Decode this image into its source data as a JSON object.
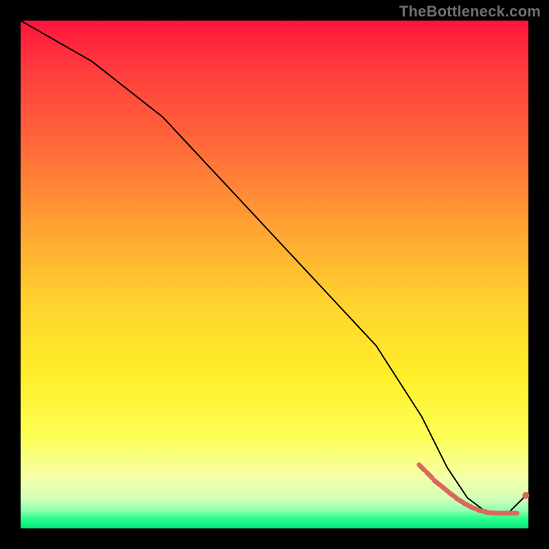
{
  "watermark": "TheBottleneck.com",
  "colors": {
    "frame_bg": "#000000",
    "marker": "#d86a5c",
    "curve": "#000000",
    "gradient_top": "#ff143c",
    "gradient_bottom": "#00e77a"
  },
  "chart_data": {
    "type": "line",
    "title": "",
    "xlabel": "",
    "ylabel": "",
    "xlim": [
      0,
      100
    ],
    "ylim": [
      0,
      100
    ],
    "grid": false,
    "curve": {
      "name": "black-curve",
      "x": [
        0,
        14,
        28,
        42,
        56,
        70,
        79,
        84,
        88,
        92,
        96,
        100
      ],
      "y": [
        100,
        92,
        81,
        66,
        51,
        36,
        22,
        12,
        6,
        3,
        3,
        7
      ]
    },
    "series": [
      {
        "name": "markers-dashed",
        "style": "dashed-markers",
        "x": [
          79,
          80.5,
          82,
          83.5,
          85,
          86.5,
          88,
          89.5,
          91,
          92.5,
          94,
          95.5,
          97
        ],
        "y": [
          12,
          10.5,
          9,
          7.8,
          6.6,
          5.5,
          4.6,
          3.9,
          3.4,
          3.1,
          3,
          3,
          3
        ]
      }
    ],
    "end_dot": {
      "x": 99.5,
      "y": 6.5
    }
  }
}
